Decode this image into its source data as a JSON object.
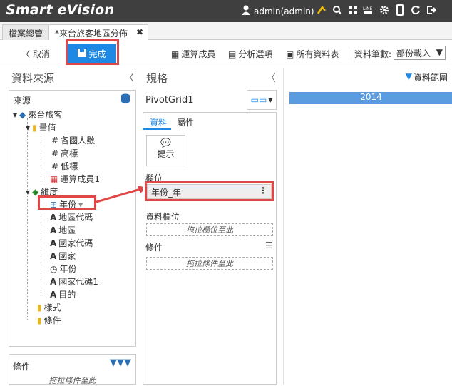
{
  "app": {
    "title": "Smart eVision",
    "user": "admin(admin)"
  },
  "tabs": [
    {
      "label": "檔案總管"
    },
    {
      "label": "*來台旅客地區分佈"
    }
  ],
  "toolbar": {
    "cancel": "取消",
    "done": "完成",
    "calc_member": "運算成員",
    "analysis_options": "分析選項",
    "all_tables": "所有資料表",
    "record_count_label": "資料筆數:",
    "record_count_value": "部份載入"
  },
  "source_panel": {
    "title": "資料來源",
    "box_label": "來源",
    "root": "來台旅客",
    "measures": "量值",
    "measure_items": [
      "各國人數",
      "高標",
      "低標"
    ],
    "calc_member": "運算成員1",
    "dimensions": "維度",
    "dimension_items": [
      "年份",
      "地區代碼",
      "地區",
      "國家代碼",
      "國家",
      "年份",
      "國家代碼1",
      "目的"
    ],
    "styles": "樣式",
    "conditions": "條件",
    "bottom_conditions": "條件",
    "bottom_drop": "拖拉條件至此"
  },
  "spec_panel": {
    "title": "規格",
    "pivot_name": "PivotGrid1",
    "tab_data": "資料",
    "tab_attr": "屬性",
    "hint": "提示",
    "column_label": "欄位",
    "column_field": "年份_年",
    "data_field_label": "資料欄位",
    "data_drop": "拖拉欄位至此",
    "condition_label": "條件",
    "condition_drop": "拖拉條件至此"
  },
  "preview": {
    "range_label": "資料範圍",
    "year_header": "2014"
  },
  "colors": {
    "accent": "#1e88e5",
    "highlight": "#e04848",
    "topbar": "#3f3f3f"
  }
}
